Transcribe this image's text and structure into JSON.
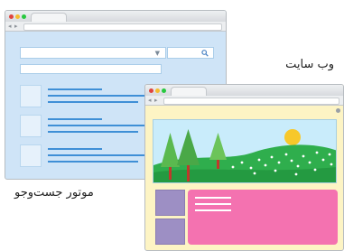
{
  "labels": {
    "website": "وب سایت",
    "search_engine": "موتور جست‌وجو"
  },
  "search_window": {
    "icons": {
      "nav": "arrow-icons",
      "dropdown": "chevron-down-icon",
      "search": "search-icon"
    },
    "colors": {
      "background": "#cfe4f7",
      "accent": "#3f8fd6"
    },
    "result_count": 3
  },
  "website_window": {
    "illustration": {
      "elements": [
        "pine-tree",
        "pine-tree",
        "pine-tree",
        "sun",
        "green-hill",
        "flower-dots"
      ]
    },
    "colors": {
      "background": "#fdf4c4",
      "sidebar": "#9d8fc4",
      "content": "#f472b0",
      "sky": "#c9ecfb",
      "hill": "#2fae4d",
      "sun": "#f7c82b"
    }
  },
  "window_controls": {
    "colors": {
      "close": "#e0443e",
      "minimize": "#f5bc2f",
      "maximize": "#27c93f"
    }
  }
}
